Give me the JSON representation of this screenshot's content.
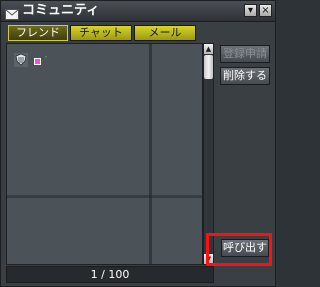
{
  "window": {
    "title": "コミュニティ",
    "minimize_glyph": "▾",
    "close_glyph": "×"
  },
  "tabs": [
    {
      "label": "フレンド",
      "active": true
    },
    {
      "label": "チャット",
      "active": false
    },
    {
      "label": "メール",
      "active": false
    }
  ],
  "friends": [
    {
      "name": "ﾞ",
      "status_color": "#ff4fd1"
    }
  ],
  "scrollbar": {
    "up_glyph": "▲",
    "down_glyph": "▼"
  },
  "buttons": {
    "register": "登録申請",
    "delete": "削除する",
    "call": "呼び出す"
  },
  "pagination": {
    "text": "1 / 100"
  }
}
